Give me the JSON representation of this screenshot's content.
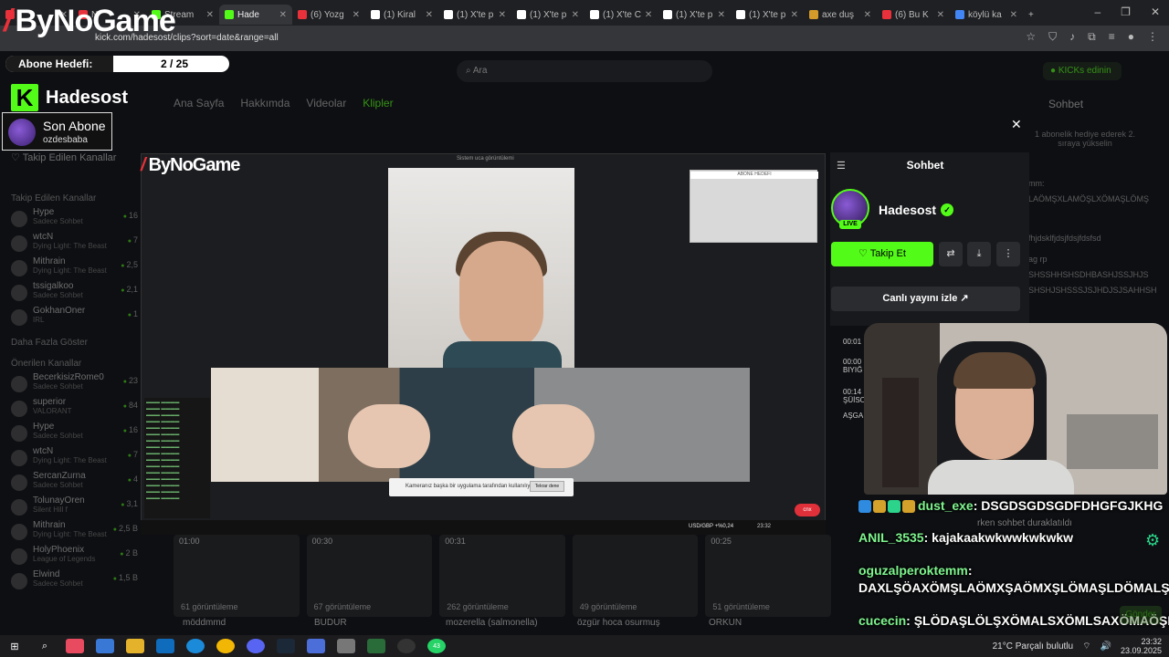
{
  "browser": {
    "tabs": [
      {
        "label": "",
        "fav": "#e8313a"
      },
      {
        "label": "N",
        "fav": "#e8313a"
      },
      {
        "label": "Stream",
        "fav": "#53fc18"
      },
      {
        "label": "Hade",
        "fav": "#53fc18",
        "active": true
      },
      {
        "label": "(6) Yozg",
        "fav": "#e8313a"
      },
      {
        "label": "(1) Kiral",
        "fav": "#ffffff"
      },
      {
        "label": "(1) X'te p",
        "fav": "#ffffff"
      },
      {
        "label": "(1) X'te p",
        "fav": "#ffffff"
      },
      {
        "label": "(1) X'te C",
        "fav": "#ffffff"
      },
      {
        "label": "(1) X'te p",
        "fav": "#ffffff"
      },
      {
        "label": "(1) X'te p",
        "fav": "#ffffff"
      },
      {
        "label": "axe duş",
        "fav": "#d49a2a"
      },
      {
        "label": "(6) Bu K",
        "fav": "#e8313a"
      },
      {
        "label": "köylü ka",
        "fav": "#4285f4"
      }
    ],
    "url": "kick.com/hadesost/clips?sort=date&range=all",
    "new_tab": "+",
    "min": "–",
    "max": "❐",
    "close": "✕"
  },
  "kick": {
    "search_placeholder": "Ara",
    "kicks_label": "KICKs edinin",
    "nav": [
      "Ana Sayfa",
      "Hakkımda",
      "Videolar",
      "Klipler"
    ],
    "chat_header": "Sohbet",
    "gift_text": "1 abonelik hediye ederek 2. sıraya yükselin",
    "sidebar": {
      "followed_title": "Takip Edilen Kanallar",
      "followed": [
        {
          "name": "Hype",
          "sub": "Sadece Sohbet",
          "viewers": "16"
        },
        {
          "name": "wtcN",
          "sub": "Dying Light: The Beast",
          "viewers": "7"
        },
        {
          "name": "Mithrain",
          "sub": "Dying Light: The Beast",
          "viewers": "2,5"
        },
        {
          "name": "tssigalkoo",
          "sub": "Sadece Sohbet",
          "viewers": "2,1"
        },
        {
          "name": "GokhanOner",
          "sub": "IRL",
          "viewers": "1"
        }
      ],
      "show_more": "Daha Fazla Göster",
      "recommended_title": "Önerilen Kanallar",
      "recommended": [
        {
          "name": "BecerkisizRome0",
          "sub": "Sadece Sohbet",
          "viewers": "23"
        },
        {
          "name": "superior",
          "sub": "VALORANT",
          "viewers": "84"
        },
        {
          "name": "Hype",
          "sub": "Sadece Sohbet",
          "viewers": "16"
        },
        {
          "name": "wtcN",
          "sub": "Dying Light: The Beast",
          "viewers": "7"
        },
        {
          "name": "SercanZurna",
          "sub": "Sadece Sohbet",
          "viewers": "4"
        },
        {
          "name": "TolunayOren",
          "sub": "Silent Hill f",
          "viewers": "3,1"
        },
        {
          "name": "Mithrain",
          "sub": "Dying Light: The Beast",
          "viewers": "2,5 B"
        },
        {
          "name": "HolyPhoenix",
          "sub": "League of Legends",
          "viewers": "2 B"
        },
        {
          "name": "Elwind",
          "sub": "Sadece Sohbet",
          "viewers": "1,5 B"
        }
      ]
    },
    "clips": [
      {
        "duration": "01:00",
        "views": "61 görüntüleme",
        "title": "möddmmd"
      },
      {
        "duration": "00:30",
        "views": "67 görüntüleme",
        "title": "BUDUR"
      },
      {
        "duration": "00:31",
        "views": "262 görüntüleme",
        "title": "mozerella (salmonella)"
      },
      {
        "duration": "",
        "views": "49 görüntüleme",
        "title": "özgür hoca osurmuş"
      },
      {
        "duration": "00:25",
        "views": "51 görüntüleme",
        "title": "ORKUN"
      }
    ],
    "bg_chat": [
      "mm:",
      "LAÖMŞXLAMÖŞLXÖMAŞLÖMŞ",
      "fhjdsklfjdsjfdsjfdsfsd",
      "ag rp",
      "SHSSHHSHSDHBASHJSSJHJS",
      "SHSHJSHSSSJSJHDJSJSAHHSH"
    ]
  },
  "overlay": {
    "brand": "ByNoGame",
    "goal_label": "Abone Hedefi:",
    "goal_count": "2 / 25",
    "goal_progress": 0.08,
    "channel_name": "Hadesost",
    "last_sub_label": "Son Abone",
    "last_sub_name": "ozdesbaba",
    "follow_side": "Takip Edilen Kanallar"
  },
  "capture": {
    "title": "Sistem uca görüntülemi",
    "warning": "Kameranız başka bir uygulama tarafından kullanılıyor.",
    "retry": "Tekrar dene",
    "abone_mini": "ABONE HEDEFI",
    "fx": "USD/GBP +%0,24",
    "clock": "23:32",
    "end_call": "cnx"
  },
  "chat_panel": {
    "title": "Sohbet",
    "channel": "Hadesost",
    "live": "LIVE",
    "follow": "Takip Et",
    "watch_live": "Canlı yayını izle",
    "timestamps": [
      {
        "time": "00:01",
        "text": ""
      },
      {
        "time": "00:00",
        "text": "BIYIĞ"
      },
      {
        "time": "00:14",
        "text": "ŞÜİSO"
      },
      {
        "time": "",
        "text": "AŞGA"
      }
    ]
  },
  "chat_messages": [
    {
      "user": "dust_exe",
      "text": "DSGDSGDSGDFDHGFGJKHG",
      "badges": [
        "#2f8be0",
        "#d4a12a",
        "#2bd48a",
        "#d4a12a"
      ]
    },
    {
      "user": "",
      "text": "rken sohbet duraklatıldı",
      "dim": true
    },
    {
      "user": "ANIL_3535",
      "text": "kajakaakwkwwkwkwkw"
    },
    {
      "user": "oguzalperoktemm",
      "text": "DAXLŞÖAXÖMŞLAÖMXŞAÖMXŞLÖMAŞLDÖMALŞX"
    },
    {
      "user": "cucecin",
      "text": "ŞLÖDAŞLÖLŞXÖMALSXÖMLSAXÖMAÖŞMDSAMÖD"
    }
  ],
  "chat_input": {
    "send": "Gönder"
  },
  "taskbar": {
    "weather": "21°C Parçalı bulutlu",
    "time": "23:32",
    "date": "23.09.2025",
    "badge_count": "43"
  }
}
